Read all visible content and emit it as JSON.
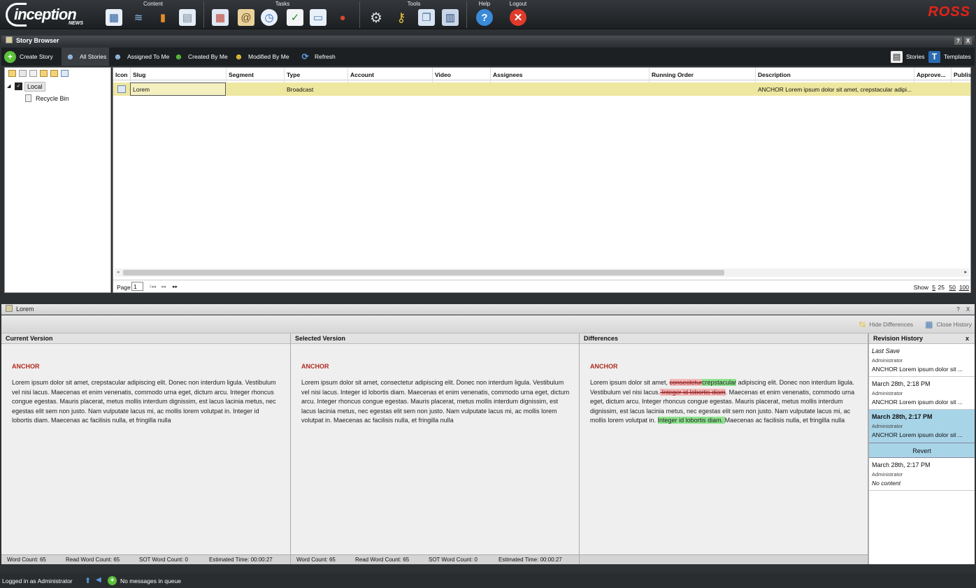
{
  "app": {
    "logo_main": "inception",
    "logo_sub": "NEWS",
    "brand": "ROSS"
  },
  "menu": {
    "groups": [
      {
        "label": "Content"
      },
      {
        "label": "Tasks"
      },
      {
        "label": "Tools"
      },
      {
        "label": "Help"
      },
      {
        "label": "Logout"
      }
    ]
  },
  "story_browser": {
    "title": "Story Browser",
    "help": "?",
    "close": "X",
    "toolbar": {
      "create": "Create Story",
      "all": "All Stories",
      "assigned": "Assigned To Me",
      "created": "Created By Me",
      "modified": "Modified By Me",
      "refresh": "Refresh",
      "stories": "Stories",
      "templates": "Templates"
    },
    "tree": {
      "root": "Local",
      "child": "Recycle Bin"
    },
    "columns": [
      "Icon",
      "Slug",
      "Segment",
      "Type",
      "Account",
      "Video",
      "Assignees",
      "Running Order",
      "Description",
      "Approve...",
      "Publis"
    ],
    "row": {
      "slug": "Lorem",
      "type": "Broadcast",
      "description": "ANCHOR Lorem ipsum dolor sit amet, crepstacular adipi..."
    },
    "pager": {
      "page_label": "Page",
      "page_value": "1",
      "first": "I◂◂",
      "prev": "◂◂",
      "next": "▸▸",
      "show": "Show",
      "sizes": [
        "5",
        "25",
        "50",
        "100"
      ]
    }
  },
  "story": {
    "title": "Lorem",
    "help": "?",
    "close": "X",
    "hide_diff": "Hide Differences",
    "close_history": "Close History",
    "current": {
      "header": "Current Version",
      "anchor": "ANCHOR",
      "text": "Lorem ipsum dolor sit amet, crepstacular adipiscing elit. Donec non interdum ligula. Vestibulum vel nisi lacus. Maecenas et enim venenatis, commodo urna eget, dictum arcu. Integer rhoncus congue egestas. Mauris placerat, metus mollis interdum dignissim, est lacus lacinia metus, nec egestas elit sem non justo. Nam vulputate lacus mi, ac mollis lorem volutpat in. Integer id lobortis diam. Maecenas ac facilisis nulla, et fringilla nulla",
      "word_count": "Word Count: 65",
      "read_word_count": "Read Word Count: 65",
      "sot_word_count": "SOT Word Count: 0",
      "est_time": "Estimated Time: 00:00:27"
    },
    "selected": {
      "header": "Selected Version",
      "anchor": "ANCHOR",
      "text": "Lorem ipsum dolor sit amet, consectetur adipiscing elit. Donec non interdum ligula. Vestibulum vel nisi lacus. Integer id lobortis diam. Maecenas et enim venenatis, commodo urna eget, dictum arcu. Integer rhoncus congue egestas. Mauris placerat, metus mollis interdum dignissim, est lacus lacinia metus, nec egestas elit sem non justo. Nam vulputate lacus mi, ac mollis lorem volutpat in. Maecenas ac facilisis nulla, et fringilla nulla",
      "word_count": "Word Count: 65",
      "read_word_count": "Read Word Count: 65",
      "sot_word_count": "SOT Word Count: 0",
      "est_time": "Estimated Time: 00:00:27"
    },
    "differences": {
      "header": "Differences",
      "anchor": "ANCHOR",
      "p1": "Lorem ipsum dolor sit amet, ",
      "del1": "consectetur",
      "ins1": "crepstacular",
      "p2": " adipiscing elit. Donec non interdum ligula. Vestibulum vel nisi lacus.",
      "del2": " Integer id lobortis diam",
      "p3": ". Maecenas et enim venenatis, commodo urna eget, dictum arcu. Integer rhoncus congue egestas. Mauris placerat, metus mollis interdum dignissim, est lacus lacinia metus, nec egestas elit sem non justo. Nam vulputate lacus mi, ac mollis lorem volutpat in. ",
      "ins2": "Integer id lobortis diam. ",
      "p4": "Maecenas ac facilisis nulla, et fringilla nulla"
    },
    "revisions": {
      "header": "Revision History",
      "close": "x",
      "items": [
        {
          "date": "Last Save",
          "user": "Administrator",
          "preview": "ANCHOR Lorem ipsum dolor sit ..."
        },
        {
          "date": "March 28th, 2:18 PM",
          "user": "Administrator",
          "preview": "ANCHOR Lorem ipsum dolor sit ..."
        },
        {
          "date": "March 28th, 2:17 PM",
          "user": "Administrator",
          "preview": "ANCHOR Lorem ipsum dolor sit ..."
        },
        {
          "date": "March 28th, 2:17 PM",
          "user": "Administrator",
          "preview": "No content"
        }
      ],
      "revert": "Revert"
    }
  },
  "status": {
    "login": "Logged in as Administrator",
    "messages": "No messages in queue"
  }
}
